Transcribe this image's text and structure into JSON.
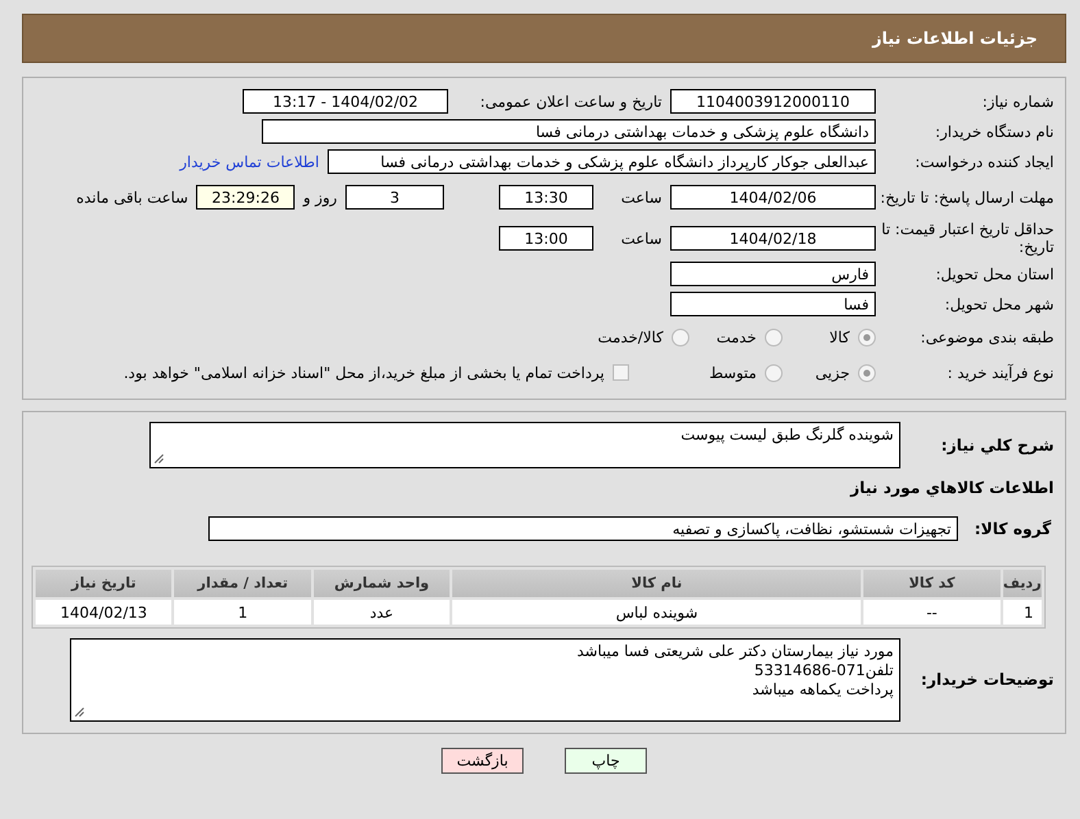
{
  "header": {
    "title": "جزئیات اطلاعات نیاز"
  },
  "need_number": {
    "label": "شماره نیاز:",
    "value": "1104003912000110"
  },
  "announce": {
    "label": "تاریخ و ساعت اعلان عمومی:",
    "value": "1404/02/02 - 13:17"
  },
  "buyer_org": {
    "label": "نام دستگاه خریدار:",
    "value": "دانشگاه علوم پزشکی و خدمات بهداشتی درمانی فسا"
  },
  "requester": {
    "label": "ایجاد کننده درخواست:",
    "value": "عبدالعلی جوکار کارپرداز دانشگاه علوم پزشکی و خدمات بهداشتی درمانی فسا",
    "link": "اطلاعات تماس خریدار"
  },
  "reply_deadline": {
    "label": "مهلت ارسال پاسخ: تا تاریخ:",
    "date": "1404/02/06",
    "time_label": "ساعت",
    "time": "13:30",
    "days": "3",
    "days_label": "روز و",
    "remaining": "23:29:26",
    "remaining_label": "ساعت باقی مانده"
  },
  "price_validity": {
    "label": "حداقل تاریخ اعتبار قیمت: تا تاریخ:",
    "date": "1404/02/18",
    "time_label": "ساعت",
    "time": "13:00"
  },
  "province": {
    "label": "استان محل تحویل:",
    "value": "فارس"
  },
  "city": {
    "label": "شهر محل تحویل:",
    "value": "فسا"
  },
  "category": {
    "label": "طبقه بندی موضوعی:",
    "options": [
      {
        "label": "کالا",
        "selected": true
      },
      {
        "label": "خدمت",
        "selected": false
      },
      {
        "label": "کالا/خدمت",
        "selected": false
      }
    ]
  },
  "process": {
    "label": "نوع فرآیند خرید :",
    "options": [
      {
        "label": "جزیی",
        "selected": true
      },
      {
        "label": "متوسط",
        "selected": false
      }
    ],
    "payment": {
      "label": "پرداخت تمام یا بخشی از مبلغ خرید،از محل \"اسناد خزانه اسلامی\" خواهد بود.",
      "checked": false
    }
  },
  "description": {
    "label": "شرح کلي نياز:",
    "value": "شوینده گلرنگ طبق لیست پیوست"
  },
  "goods_title": "اطلاعات کالاهاي مورد نياز",
  "goods_group": {
    "label": "گروه کالا:",
    "value": "تجهیزات شستشو، نظافت، پاکسازی و تصفیه"
  },
  "table": {
    "columns": [
      "ردیف",
      "کد کالا",
      "نام کالا",
      "واحد شمارش",
      "تعداد / مقدار",
      "تاریخ نیاز"
    ],
    "rows": [
      [
        "1",
        "--",
        "شوینده لباس",
        "عدد",
        "1",
        "1404/02/13"
      ]
    ]
  },
  "buyer_notes": {
    "label": "توضیحات خریدار:",
    "lines": [
      "مورد نیاز بیمارستان دکتر علی شریعتی فسا میباشد",
      "تلفن071-53314686",
      "پرداخت یکماهه میباشد"
    ]
  },
  "buttons": [
    {
      "label": "چاپ",
      "kind": "print"
    },
    {
      "label": "بازگشت",
      "kind": "back"
    }
  ]
}
